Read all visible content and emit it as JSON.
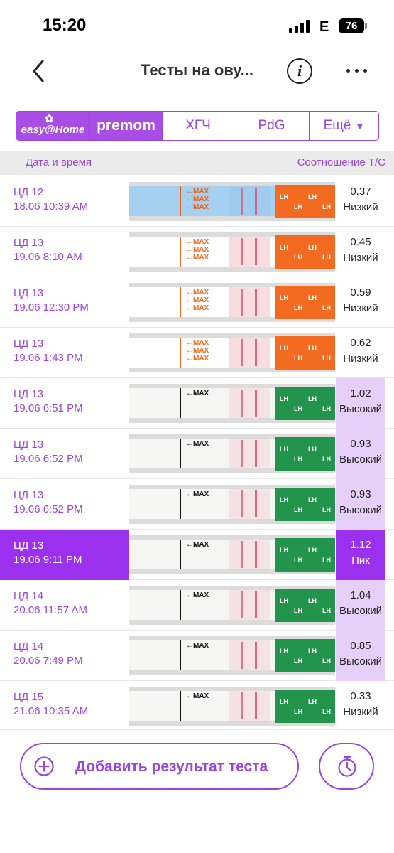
{
  "status_bar": {
    "time": "15:20",
    "network": "E",
    "battery": "76"
  },
  "header": {
    "title": "Тесты на ову...",
    "back_icon": "chevron-left-icon",
    "info_icon": "info-icon",
    "more_icon": "more-horizontal-icon"
  },
  "brand_tabs": {
    "easy_home": "easy@Home",
    "premom": "premom",
    "hcg": "ХГЧ",
    "pdg": "PdG",
    "more": "Ещё",
    "more_caret": "▼"
  },
  "columns": {
    "left": "Дата и время",
    "right": "Соотношение Т/С"
  },
  "rows": [
    {
      "cd": "ЦД 12",
      "datetime": "18.06 10:39 AM",
      "ratio": "0.37",
      "level": "Низкий",
      "strip": "blue"
    },
    {
      "cd": "ЦД 13",
      "datetime": "19.06 8:10 AM",
      "ratio": "0.45",
      "level": "Низкий",
      "strip": "orange"
    },
    {
      "cd": "ЦД 13",
      "datetime": "19.06 12:30 PM",
      "ratio": "0.59",
      "level": "Низкий",
      "strip": "orange"
    },
    {
      "cd": "ЦД 13",
      "datetime": "19.06 1:43 PM",
      "ratio": "0.62",
      "level": "Низкий",
      "strip": "orange"
    },
    {
      "cd": "ЦД 13",
      "datetime": "19.06 6:51 PM",
      "ratio": "1.02",
      "level": "Высокий",
      "strip": "green"
    },
    {
      "cd": "ЦД 13",
      "datetime": "19.06 6:52 PM",
      "ratio": "0.93",
      "level": "Высокий",
      "strip": "green"
    },
    {
      "cd": "ЦД 13",
      "datetime": "19.06 6:52 PM",
      "ratio": "0.93",
      "level": "Высокий",
      "strip": "green"
    },
    {
      "cd": "ЦД 13",
      "datetime": "19.06 9:11 PM",
      "ratio": "1.12",
      "level": "Пик",
      "strip": "green",
      "selected": true
    },
    {
      "cd": "ЦД 14",
      "datetime": "20.06 11:57 AM",
      "ratio": "1.04",
      "level": "Высокий",
      "strip": "green"
    },
    {
      "cd": "ЦД 14",
      "datetime": "20.06 7:49 PM",
      "ratio": "0.85",
      "level": "Высокий",
      "strip": "green"
    },
    {
      "cd": "ЦД 15",
      "datetime": "21.06 10:35 AM",
      "ratio": "0.33",
      "level": "Низкий",
      "strip": "green"
    }
  ],
  "strip_text": {
    "max": "MAX",
    "lh": "LH"
  },
  "footer": {
    "add_label": "Добавить результат теста",
    "add_icon": "plus-circle-icon",
    "timer_icon": "timer-icon"
  },
  "colors": {
    "accent": "#9b45e0",
    "selected": "#9b30ef",
    "high_bg": "#e6cff9"
  }
}
